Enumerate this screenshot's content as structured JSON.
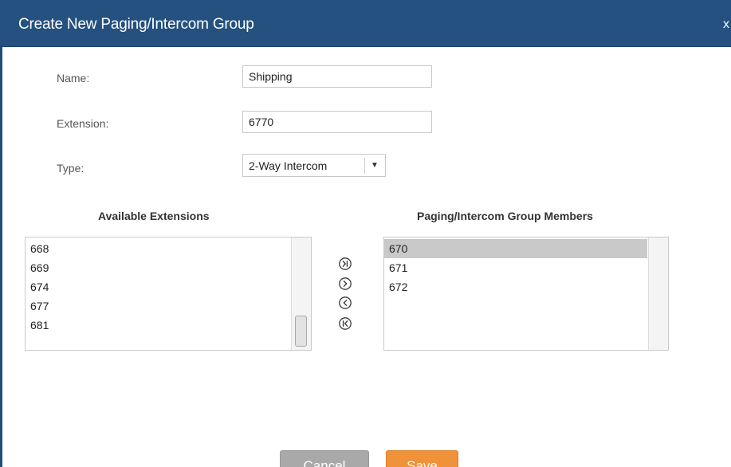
{
  "dialog": {
    "title": "Create New Paging/Intercom Group",
    "close_label": "x"
  },
  "form": {
    "name_label": "Name:",
    "name_value": "Shipping",
    "extension_label": "Extension:",
    "extension_value": "6770",
    "type_label": "Type:",
    "type_value": "2-Way Intercom"
  },
  "available": {
    "title": "Available Extensions",
    "items": [
      "668",
      "669",
      "674",
      "677",
      "681"
    ]
  },
  "members": {
    "title": "Paging/Intercom Group Members",
    "items": [
      "670",
      "671",
      "672"
    ],
    "selected_index": 0
  },
  "transfer": {
    "add_all_icon": "double-chevron-right-circle-icon",
    "add_icon": "chevron-right-circle-icon",
    "remove_icon": "chevron-left-circle-icon",
    "remove_all_icon": "double-chevron-left-circle-icon"
  },
  "buttons": {
    "cancel_label": "Cancel",
    "save_label": "Save"
  },
  "colors": {
    "titlebar": "#24517f",
    "save_button": "#f0923a",
    "cancel_button": "#a9a9a9",
    "selected_row": "#c9c9c9"
  }
}
